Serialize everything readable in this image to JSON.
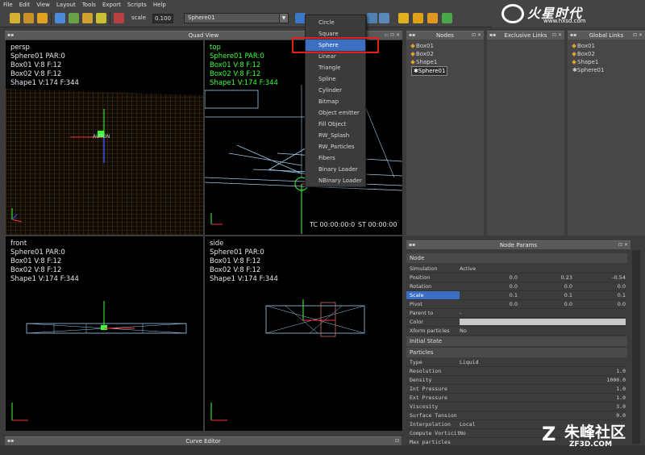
{
  "menubar": [
    "File",
    "Edit",
    "View",
    "Layout",
    "Tools",
    "Export",
    "Scripts",
    "Help"
  ],
  "toolbar": {
    "scale_label": "scale",
    "scale_value": "0.100",
    "node_select": "Sphere01"
  },
  "logo": {
    "text": "火星时代",
    "url": "www.hxsd.com"
  },
  "quad_view": {
    "title": "Quad View",
    "persp": {
      "lines": [
        "persp",
        "Sphere01 PAR:0",
        "Box01 V:8 F:12",
        "Box02 V:8 F:12",
        "Shape1 V:174 F:344"
      ],
      "gizmo_label": "AUTON"
    },
    "top": {
      "lines": [
        "top",
        "Sphere01 PAR:0",
        "Box01 V:8 F:12",
        "Box02 V:8 F:12",
        "Shape1 V:174 F:344"
      ],
      "tc": "TC 00:00:00:0",
      "st": "ST 00:00:00"
    },
    "front": {
      "lines": [
        "front",
        "Sphere01 PAR:0",
        "Box01 V:8 F:12",
        "Box02 V:8 F:12",
        "Shape1 V:174 F:344"
      ]
    },
    "side": {
      "lines": [
        "side",
        "Sphere01 PAR:0",
        "Box01 V:8 F:12",
        "Box02 V:8 F:12",
        "Shape1 V:174 F:344"
      ]
    }
  },
  "nodes_panel": {
    "title": "Nodes",
    "items": [
      "Box01",
      "Box02",
      "Shape1",
      "Sphere01"
    ]
  },
  "exclusive_links": {
    "title": "Exclusive Links"
  },
  "global_links": {
    "title": "Global Links",
    "items": [
      "Box01",
      "Box02",
      "Shape1",
      "Sphere01"
    ]
  },
  "dropdown": {
    "items": [
      "Circle",
      "Square",
      "Sphere",
      "Linear",
      "Triangle",
      "Spline",
      "Cylinder",
      "Bitmap",
      "Object emitter",
      "Fill Object",
      "RW_Splash",
      "RW_Particles",
      "Fibers",
      "Binary Loader",
      "NBinary Loader"
    ],
    "selected": "Sphere"
  },
  "node_params": {
    "title": "Node Params",
    "section_node": "Node",
    "simulation": {
      "label": "Simulation",
      "value": "Active"
    },
    "position": {
      "label": "Position",
      "x": "0.0",
      "y": "0.23",
      "z": "-0.54"
    },
    "rotation": {
      "label": "Rotation",
      "x": "0.0",
      "y": "0.0",
      "z": "0.0"
    },
    "scale": {
      "label": "Scale",
      "x": "0.1",
      "y": "0.1",
      "z": "0.1"
    },
    "pivot": {
      "label": "Pivot",
      "x": "0.0",
      "y": "0.0",
      "z": "0.0"
    },
    "parent_to": {
      "label": "Parent to",
      "value": "-"
    },
    "color": {
      "label": "Color"
    },
    "xform": {
      "label": "Xform particles",
      "value": "No"
    },
    "section_initial": "Initial State",
    "section_particles": "Particles",
    "type": {
      "label": "Type",
      "value": "Liquid"
    },
    "resolution": {
      "label": "Resolution",
      "value": "1.0"
    },
    "density": {
      "label": "Density",
      "value": "1000.0"
    },
    "int_pressure": {
      "label": "Int Pressure",
      "value": "1.0"
    },
    "ext_pressure": {
      "label": "Ext Pressure",
      "value": "1.0"
    },
    "viscosity": {
      "label": "Viscosity",
      "value": "3.0"
    },
    "surface_tension": {
      "label": "Surface Tension",
      "value": "0.0"
    },
    "interpolation": {
      "label": "Interpolation",
      "value": "Local"
    },
    "compute_vorticity": {
      "label": "Compute Vorticit",
      "value": "No"
    },
    "max_particles": {
      "label": "Max particles"
    }
  },
  "curve_editor": {
    "title": "Curve Editor"
  },
  "watermark": {
    "text": "朱峰社区",
    "url": "ZF3D.COM"
  }
}
